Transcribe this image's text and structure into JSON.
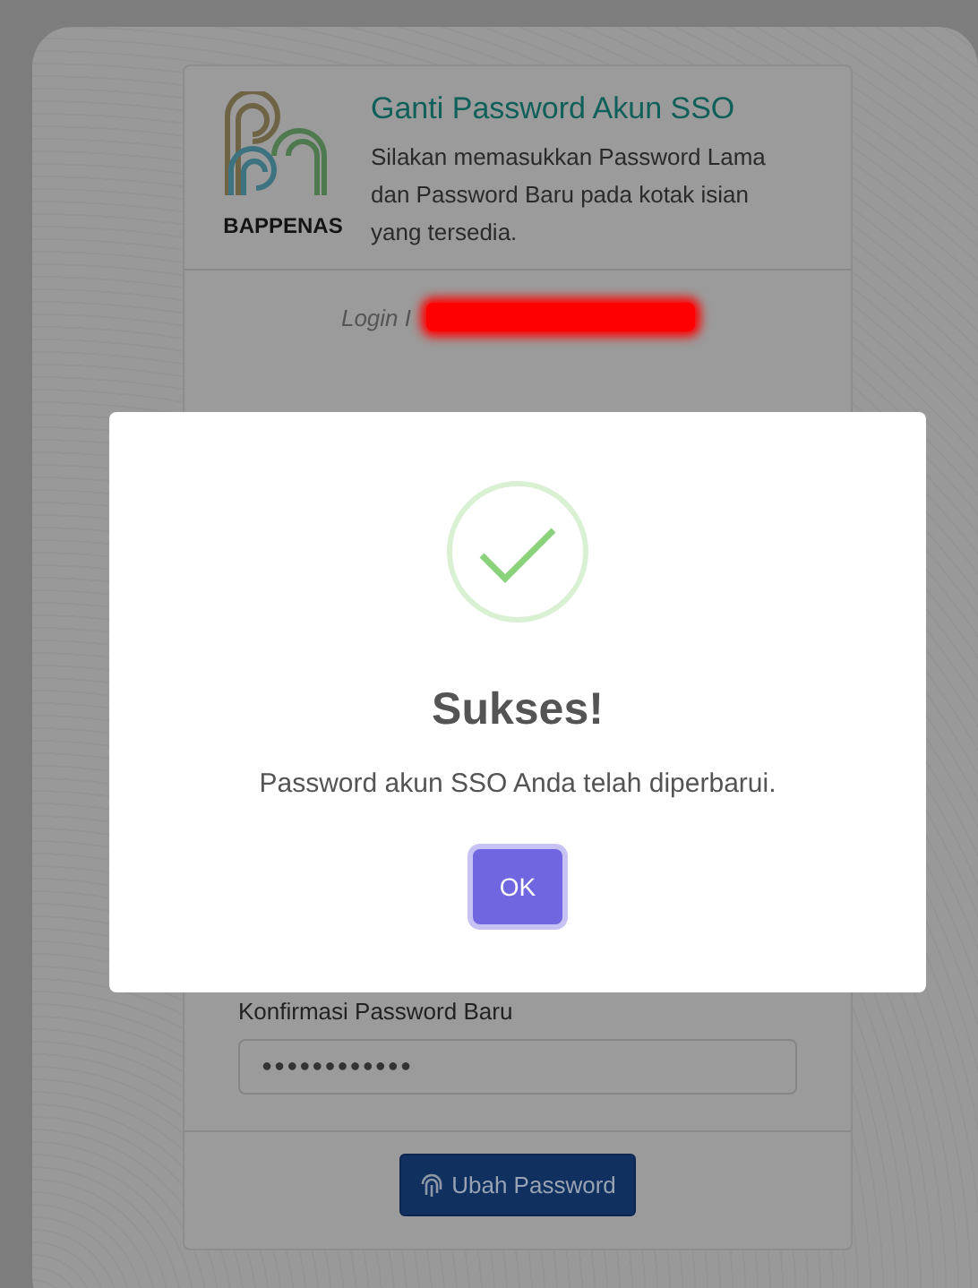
{
  "header": {
    "logo_text": "BAPPENAS",
    "title": "Ganti Password Akun SSO",
    "description": "Silakan memasukkan Password Lama dan Password Baru pada kotak isian yang tersedia."
  },
  "login": {
    "label": "Login I",
    "redacted": true
  },
  "confirm_field": {
    "label": "Konfirmasi Password Baru",
    "value": "●●●●●●●●●●●●"
  },
  "submit_button": "Ubah Password",
  "dialog": {
    "kind": "success",
    "title": "Sukses!",
    "message": "Password akun SSO Anda telah diperbarui.",
    "button": "OK"
  }
}
